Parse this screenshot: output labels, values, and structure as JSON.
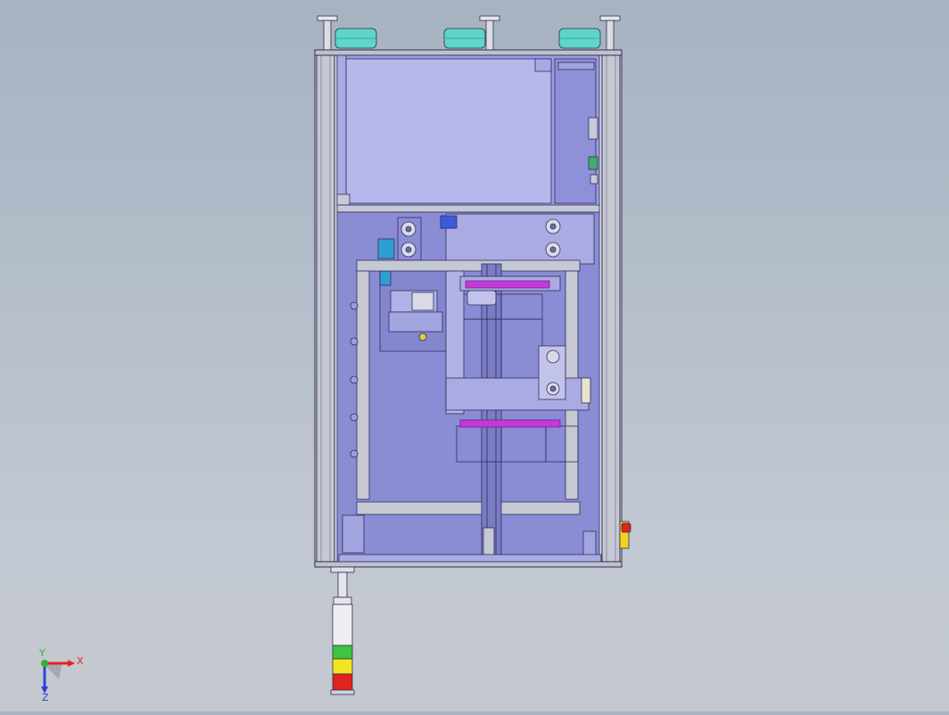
{
  "viewport": {
    "description_label": "",
    "colors": {
      "background_top": "#a7b2c2",
      "background_bottom": "#c4c9d0",
      "frame": "#c9ccd6",
      "panel_fill": "#8d8fd6",
      "top_panel_fill": "#b7b7ec",
      "accent_magenta": "#c23bd8",
      "roller_teal": "#5fd5c8",
      "edge": "#3a3a6a"
    }
  },
  "coordinate_triad": {
    "x_label": "X",
    "y_label": "Y",
    "z_label": "Z",
    "x_color": "#e8231f",
    "y_color": "#2bb52b",
    "z_color": "#2d43d6"
  },
  "tower_light": {
    "segments": [
      "green",
      "yellow",
      "red"
    ],
    "colors": {
      "green": "#3ec43e",
      "yellow": "#f2e51d",
      "red": "#e0231d"
    }
  },
  "emergency_stop": {
    "colors": {
      "cap": "#e0231d",
      "base": "#f2d21d"
    }
  }
}
